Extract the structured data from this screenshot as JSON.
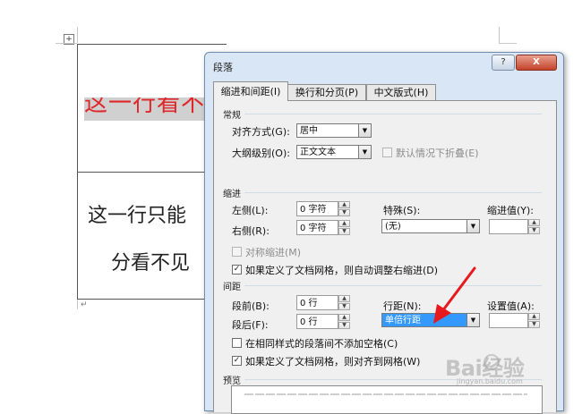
{
  "document": {
    "move_handle_glyph": "+",
    "row1_text": "这一行看不见",
    "row2_line1": "这一行只能",
    "row2_line2": "分看不见",
    "paragraph_mark": "↵"
  },
  "dialog": {
    "title": "段落",
    "help_label": "?",
    "close_label": "X",
    "tabs": [
      {
        "label": "缩进和间距(I)",
        "active": true
      },
      {
        "label": "换行和分页(P)",
        "active": false
      },
      {
        "label": "中文版式(H)",
        "active": false
      }
    ],
    "general": {
      "heading": "常规",
      "alignment_label": "对齐方式(G):",
      "alignment_value": "居中",
      "outline_label": "大纲级别(O):",
      "outline_value": "正文文本",
      "collapse_label": "默认情况下折叠(E)"
    },
    "indent": {
      "heading": "缩进",
      "left_label": "左侧(L):",
      "left_value": "0 字符",
      "right_label": "右侧(R):",
      "right_value": "0 字符",
      "special_label": "特殊(S):",
      "special_value": "(无)",
      "by_label": "缩进值(Y):",
      "by_value": "",
      "mirror_label": "对称缩进(M)",
      "auto_adjust_label": "如果定义了文档网格，则自动调整右缩进(D)"
    },
    "spacing": {
      "heading": "间距",
      "before_label": "段前(B):",
      "before_value": "0 行",
      "after_label": "段后(F):",
      "after_value": "0 行",
      "line_label": "行距(N):",
      "line_value": "单倍行距",
      "at_label": "设置值(A):",
      "at_value": "",
      "no_space_label": "在相同样式的段落间不添加空格(C)",
      "snap_grid_label": "如果定义了文档网格，则对齐到网格(W)"
    },
    "preview": {
      "heading": "预览"
    }
  },
  "watermark": {
    "brand": "Bai经验",
    "url": "jingyan.baidu.com"
  },
  "colors": {
    "red_text": "#e0262b",
    "selection_blue": "#3399ff",
    "dialog_frame": "#d9e6f5",
    "arrow_red": "#e8191c"
  }
}
